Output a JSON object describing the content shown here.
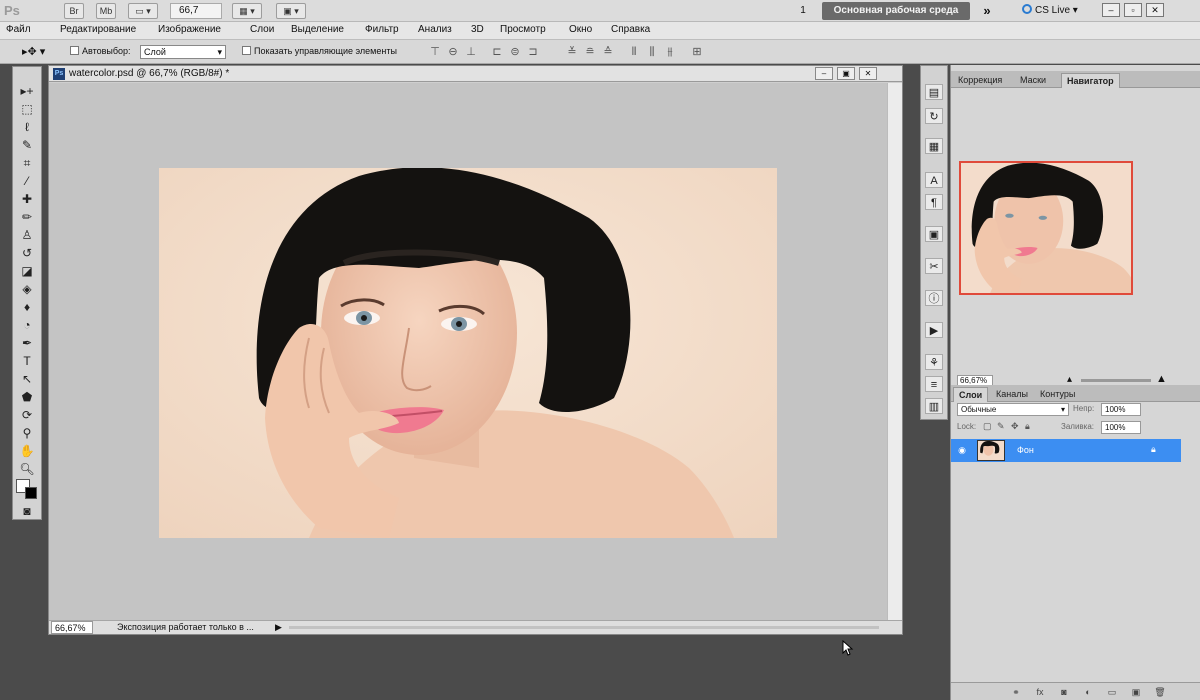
{
  "app": {
    "logo": "Ps",
    "bar_buttons": [
      "Br",
      "Mb"
    ],
    "zoom_value": "66,7",
    "workspace_number": "1",
    "workspace_label": "Основная рабочая среда",
    "workspace_more": "»",
    "cs_live": "CS Live"
  },
  "menu": [
    "Файл",
    "Редактирование",
    "Изображение",
    "Слои",
    "Выделение",
    "Фильтр",
    "Анализ",
    "3D",
    "Просмотр",
    "Окно",
    "Справка"
  ],
  "options": {
    "autoselect_label": "Автовыбор:",
    "layer_select_value": "Слой",
    "show_controls_label": "Показать управляющие элементы"
  },
  "document": {
    "title": "watercolor.psd @ 66,7% (RGB/8#) *",
    "zoom_status": "66,67%",
    "status_info": "Экспозиция работает только в ..."
  },
  "panels": {
    "top_tabs": [
      "Коррекция",
      "Маски",
      "Навигатор"
    ],
    "navigator_zoom": "66,67%",
    "layer_tabs": [
      "Слои",
      "Каналы",
      "Контуры"
    ],
    "blend_mode": "Обычные",
    "opacity_label": "Непр:",
    "opacity_value": "100%",
    "lock_label": "Lock:",
    "fill_label": "Заливка:",
    "fill_value": "100%",
    "layer_name": "Фон"
  },
  "colors": {
    "accent": "#3c8ef2",
    "nav_frame": "#e04a3a",
    "workspace_btn": "#6a6a6a"
  }
}
